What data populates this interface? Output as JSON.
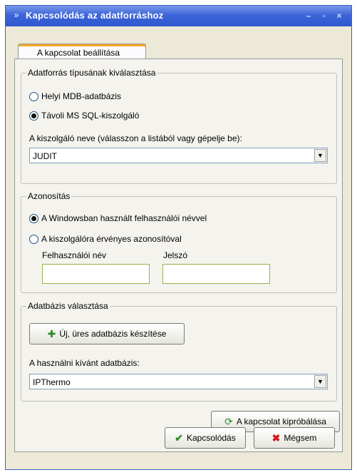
{
  "window": {
    "title": "Kapcsolódás az adatforráshoz"
  },
  "tab": {
    "label": "A kapcsolat beállítása"
  },
  "datasource": {
    "legend": "Adatforrás típusának kiválasztása",
    "option_local": "Helyi MDB-adatbázis",
    "option_remote": "Távoli MS SQL-kiszolgáló",
    "server_label": "A kiszolgáló neve (válasszon a listából vagy gépelje be):",
    "server_value": "JUDIT"
  },
  "auth": {
    "legend": "Azonosítás",
    "option_windows": "A Windowsban használt felhasználói névvel",
    "option_server": "A kiszolgálóra érvényes azonosítóval",
    "username_label": "Felhasználói név",
    "password_label": "Jelszó"
  },
  "database": {
    "legend": "Adatbázis választása",
    "new_button": "Új, üres adatbázis készítése",
    "db_label": "A használni kívánt adatbázis:",
    "db_value": "IPThermo"
  },
  "buttons": {
    "test": "A kapcsolat kipróbálása",
    "connect": "Kapcsolódás",
    "cancel": "Mégsem"
  },
  "icons": {
    "title": "app-icon",
    "new_db": "new-database-icon",
    "test": "refresh-icon",
    "connect": "check-icon",
    "cancel": "x-icon"
  }
}
